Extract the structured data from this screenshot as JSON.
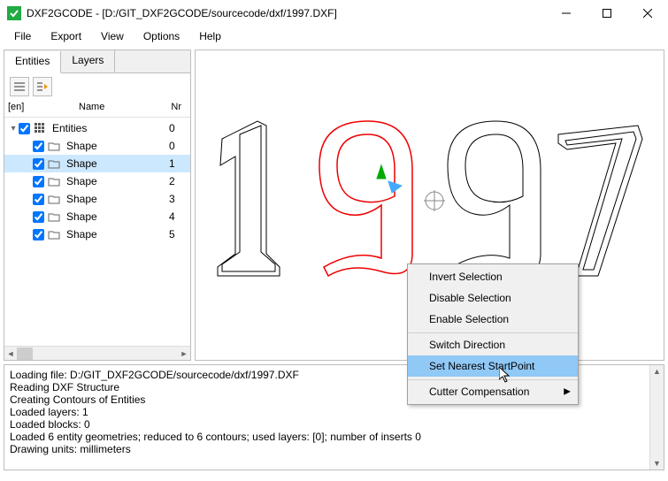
{
  "window": {
    "title": "DXF2GCODE - [D:/GIT_DXF2GCODE/sourcecode/dxf/1997.DXF]"
  },
  "menu": {
    "file": "File",
    "export": "Export",
    "view": "View",
    "options": "Options",
    "help": "Help"
  },
  "tabs": {
    "entities": "Entities",
    "layers": "Layers"
  },
  "tree": {
    "headers": {
      "en": "[en]",
      "name": "Name",
      "nr": "Nr"
    },
    "root": {
      "name": "Entities",
      "nr": "0"
    },
    "shapes": [
      {
        "name": "Shape",
        "nr": "0"
      },
      {
        "name": "Shape",
        "nr": "1"
      },
      {
        "name": "Shape",
        "nr": "2"
      },
      {
        "name": "Shape",
        "nr": "3"
      },
      {
        "name": "Shape",
        "nr": "4"
      },
      {
        "name": "Shape",
        "nr": "5"
      }
    ]
  },
  "context_menu": {
    "invert": "Invert Selection",
    "disable": "Disable Selection",
    "enable": "Enable Selection",
    "switch": "Switch Direction",
    "startpoint": "Set Nearest StartPoint",
    "cutter": "Cutter Compensation"
  },
  "log": {
    "l0": "Loading file: D:/GIT_DXF2GCODE/sourcecode/dxf/1997.DXF",
    "l1": "Reading DXF Structure",
    "l2": "Creating Contours of Entities",
    "l3": "Loaded layers: 1",
    "l4": "Loaded blocks: 0",
    "l5": "Loaded 6 entity geometries; reduced to 6 contours; used layers: [0]; number of inserts 0",
    "l6": "Drawing units: millimeters"
  }
}
